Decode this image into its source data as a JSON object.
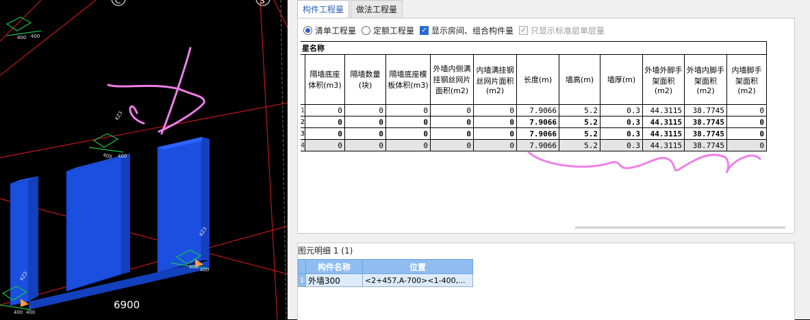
{
  "viewport": {
    "axis_labels": [
      "C",
      "S"
    ],
    "dimension_label": "6900",
    "wall_labels": [
      "KZ3",
      "KZ3",
      "KZ3"
    ],
    "colors": {
      "wall": "#1a4fe0",
      "grid_red": "#c2181c",
      "grid_green": "#17c24d"
    }
  },
  "tabs": [
    {
      "label": "构件工程量",
      "active": true
    },
    {
      "label": "做法工程量",
      "active": false
    }
  ],
  "options": {
    "bill_qty": "清单工程量",
    "quota_qty": "定额工程量",
    "show_rooms": "显示房间、组合构件量",
    "std_floor_only": "只显示标准层单层量"
  },
  "table": {
    "name_header": "星名称",
    "columns": [
      "隔墙底座体积(m3)",
      "隔墙数量(块)",
      "隔墙底座模板体积(m3)",
      "外墙内侧满挂钢丝网片面积(m2)",
      "内墙满挂钢丝网片面积(m2)",
      "长度(m)",
      "墙高(m)",
      "墙厚(m)",
      "外墙外脚手架面积(m2)",
      "外墙内脚手架面积(m2)",
      "内墙脚手架面积(m2)"
    ],
    "rows": [
      {
        "num": "1",
        "style": "normal",
        "cells": [
          "0",
          "0",
          "0",
          "0",
          "0",
          "7.9066",
          "5.2",
          "0.3",
          "44.3115",
          "38.7745",
          "0"
        ]
      },
      {
        "num": "2",
        "style": "bold",
        "cells": [
          "0",
          "0",
          "0",
          "0",
          "0",
          "7.9066",
          "5.2",
          "0.3",
          "44.3115",
          "38.7745",
          "0"
        ]
      },
      {
        "num": "3",
        "style": "bold",
        "cells": [
          "0",
          "0",
          "0",
          "0",
          "0",
          "7.9066",
          "5.2",
          "0.3",
          "44.3115",
          "38.7745",
          "0"
        ]
      },
      {
        "num": "4",
        "style": "grey",
        "cells": [
          "0",
          "0",
          "0",
          "0",
          "0",
          "7.9066",
          "5.2",
          "0.3",
          "44.3115",
          "38.7745",
          "0"
        ]
      }
    ]
  },
  "detail": {
    "title": "图元明细  1 (1)",
    "columns": [
      "构件名称",
      "位置"
    ],
    "rows": [
      {
        "num": "1",
        "name": "外墙300",
        "position": "<2+457,A-700><1-400,..."
      }
    ]
  }
}
